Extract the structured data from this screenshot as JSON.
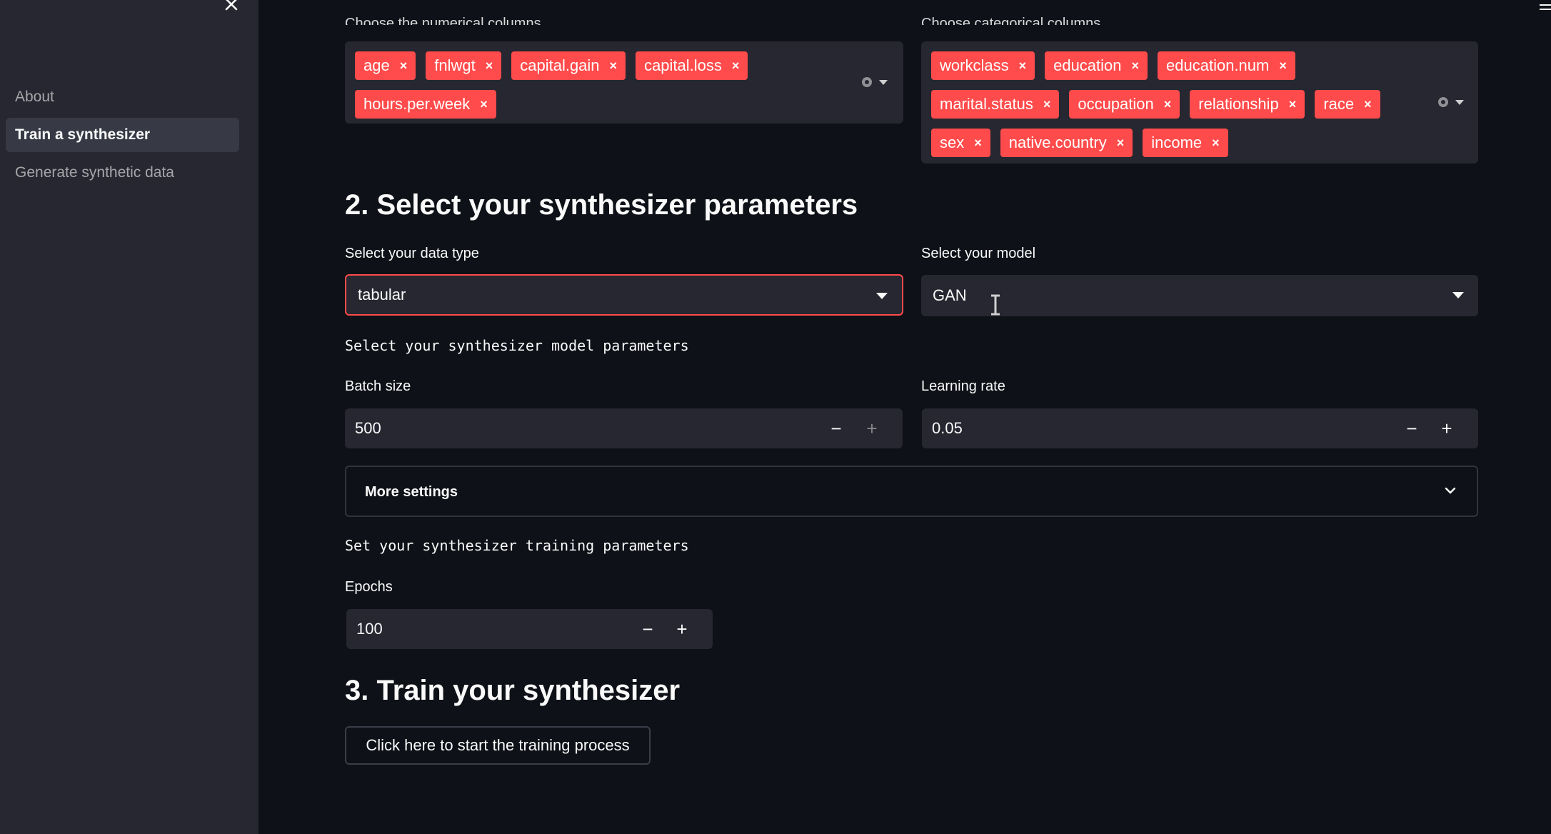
{
  "sidebar": {
    "items": [
      {
        "label": "About"
      },
      {
        "label": "Train a synthesizer"
      },
      {
        "label": "Generate synthetic data"
      }
    ]
  },
  "numerical": {
    "label": "Choose the numerical columns",
    "tags": [
      "age",
      "fnlwgt",
      "capital.gain",
      "capital.loss",
      "hours.per.week"
    ]
  },
  "categorical": {
    "label": "Choose categorical columns",
    "tags": [
      "workclass",
      "education",
      "education.num",
      "marital.status",
      "occupation",
      "relationship",
      "race",
      "sex",
      "native.country",
      "income"
    ]
  },
  "section2": {
    "heading": "2. Select your synthesizer parameters",
    "data_type_label": "Select your data type",
    "data_type_value": "tabular",
    "model_label": "Select your model",
    "model_value": "GAN",
    "model_params_text": "Select your synthesizer model parameters",
    "batch_size_label": "Batch size",
    "batch_size_value": "500",
    "learning_rate_label": "Learning rate",
    "learning_rate_value": "0.05",
    "more_settings_label": "More settings",
    "training_params_text": "Set your synthesizer training parameters",
    "epochs_label": "Epochs",
    "epochs_value": "100"
  },
  "section3": {
    "heading": "3. Train your synthesizer",
    "button_label": "Click here to start the training process"
  },
  "glyphs": {
    "remove": "×",
    "minus": "−",
    "plus": "+"
  },
  "colors": {
    "accent": "#ff4b4b",
    "background": "#0e1117",
    "sidebar": "#262730"
  }
}
